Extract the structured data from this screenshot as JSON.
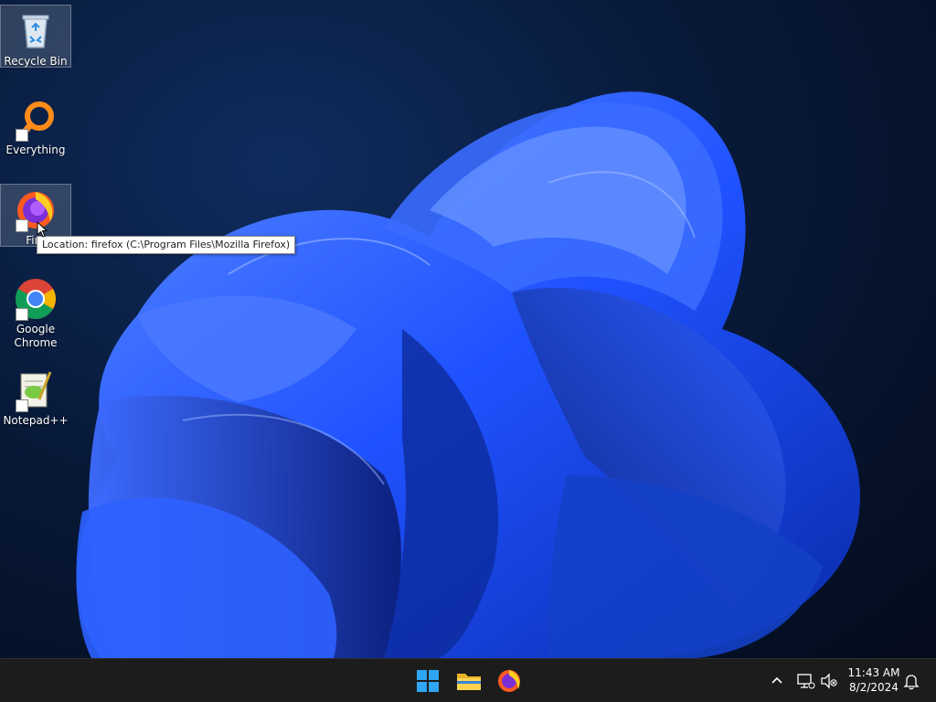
{
  "desktop_icons": [
    {
      "id": "recycle-bin",
      "label": "Recycle Bin",
      "shortcut": false,
      "selected": true
    },
    {
      "id": "everything",
      "label": "Everything",
      "shortcut": true,
      "selected": false
    },
    {
      "id": "firefox",
      "label": "Firefox",
      "label_visible": "Fire",
      "shortcut": true,
      "selected": true
    },
    {
      "id": "google-chrome",
      "label": "Google Chrome",
      "shortcut": true,
      "selected": false
    },
    {
      "id": "notepad-plus-plus",
      "label": "Notepad++",
      "shortcut": true,
      "selected": false
    }
  ],
  "tooltip": {
    "text": "Location: firefox (C:\\Program Files\\Mozilla Firefox)"
  },
  "taskbar": {
    "pinned": [
      {
        "name": "start-button",
        "icon": "windows-logo-icon"
      },
      {
        "name": "file-explorer-button",
        "icon": "folder-icon"
      },
      {
        "name": "firefox-taskbar-button",
        "icon": "firefox-icon"
      }
    ],
    "tray": {
      "overflow_icon": "chevron-up-icon",
      "network_icon": "network-icon",
      "volume_icon": "speaker-muted-icon",
      "notifications_icon": "bell-icon"
    },
    "clock": {
      "time": "11:43 AM",
      "date": "8/2/2024"
    }
  },
  "colors": {
    "taskbar_bg": "#1c1c1c",
    "wallpaper_accent": "#1f52ff",
    "desktop_bg": "#06122b"
  }
}
